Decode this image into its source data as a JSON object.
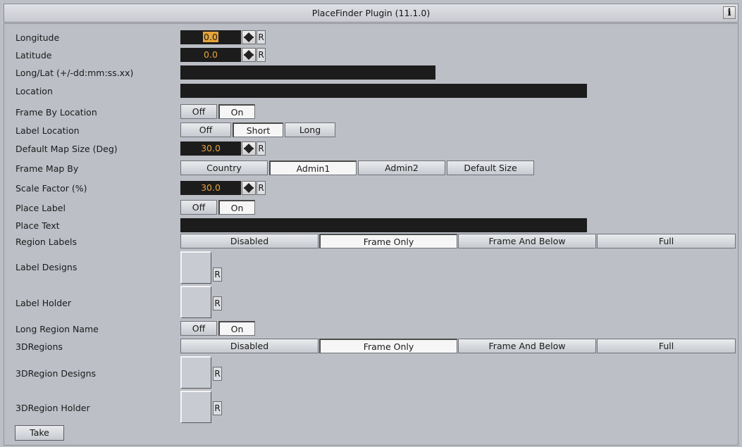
{
  "title": "PlaceFinder Plugin (11.1.0)",
  "info_label": "i",
  "reset_label": "R",
  "fields": {
    "longitude": {
      "label": "Longitude",
      "value": "0.0"
    },
    "latitude": {
      "label": "Latitude",
      "value": "0.0"
    },
    "longlat": {
      "label": "Long/Lat (+/-dd:mm:ss.xx)",
      "value": ""
    },
    "location": {
      "label": "Location",
      "value": ""
    },
    "frame_by_location": {
      "label": "Frame By Location",
      "options": [
        "Off",
        "On"
      ],
      "selected": "On"
    },
    "label_location": {
      "label": "Label Location",
      "options": [
        "Off",
        "Short",
        "Long"
      ],
      "selected": "Short"
    },
    "default_map_size": {
      "label": "Default Map Size (Deg)",
      "value": "30.0"
    },
    "frame_map_by": {
      "label": "Frame Map By",
      "options": [
        "Country",
        "Admin1",
        "Admin2",
        "Default Size"
      ],
      "selected": "Admin1"
    },
    "scale_factor": {
      "label": "Scale Factor (%)",
      "value": "30.0"
    },
    "place_label": {
      "label": "Place Label",
      "options": [
        "Off",
        "On"
      ],
      "selected": "On"
    },
    "place_text": {
      "label": "Place Text",
      "value": ""
    },
    "region_labels": {
      "label": "Region Labels",
      "options": [
        "Disabled",
        "Frame Only",
        "Frame And Below",
        "Full"
      ],
      "selected": "Frame Only"
    },
    "label_designs": {
      "label": "Label  Designs"
    },
    "label_holder": {
      "label": "Label Holder"
    },
    "long_region_name": {
      "label": "Long Region Name",
      "options": [
        "Off",
        "On"
      ],
      "selected": "On"
    },
    "regions_3d": {
      "label": "3DRegions",
      "options": [
        "Disabled",
        "Frame Only",
        "Frame And Below",
        "Full"
      ],
      "selected": "Frame Only"
    },
    "region_designs_3d": {
      "label": "3DRegion Designs"
    },
    "region_holder_3d": {
      "label": "3DRegion Holder"
    }
  },
  "take_label": "Take",
  "colors": {
    "background": "#bcbfc6",
    "field": "#1c1c1c",
    "value_text": "#e6a43a"
  }
}
